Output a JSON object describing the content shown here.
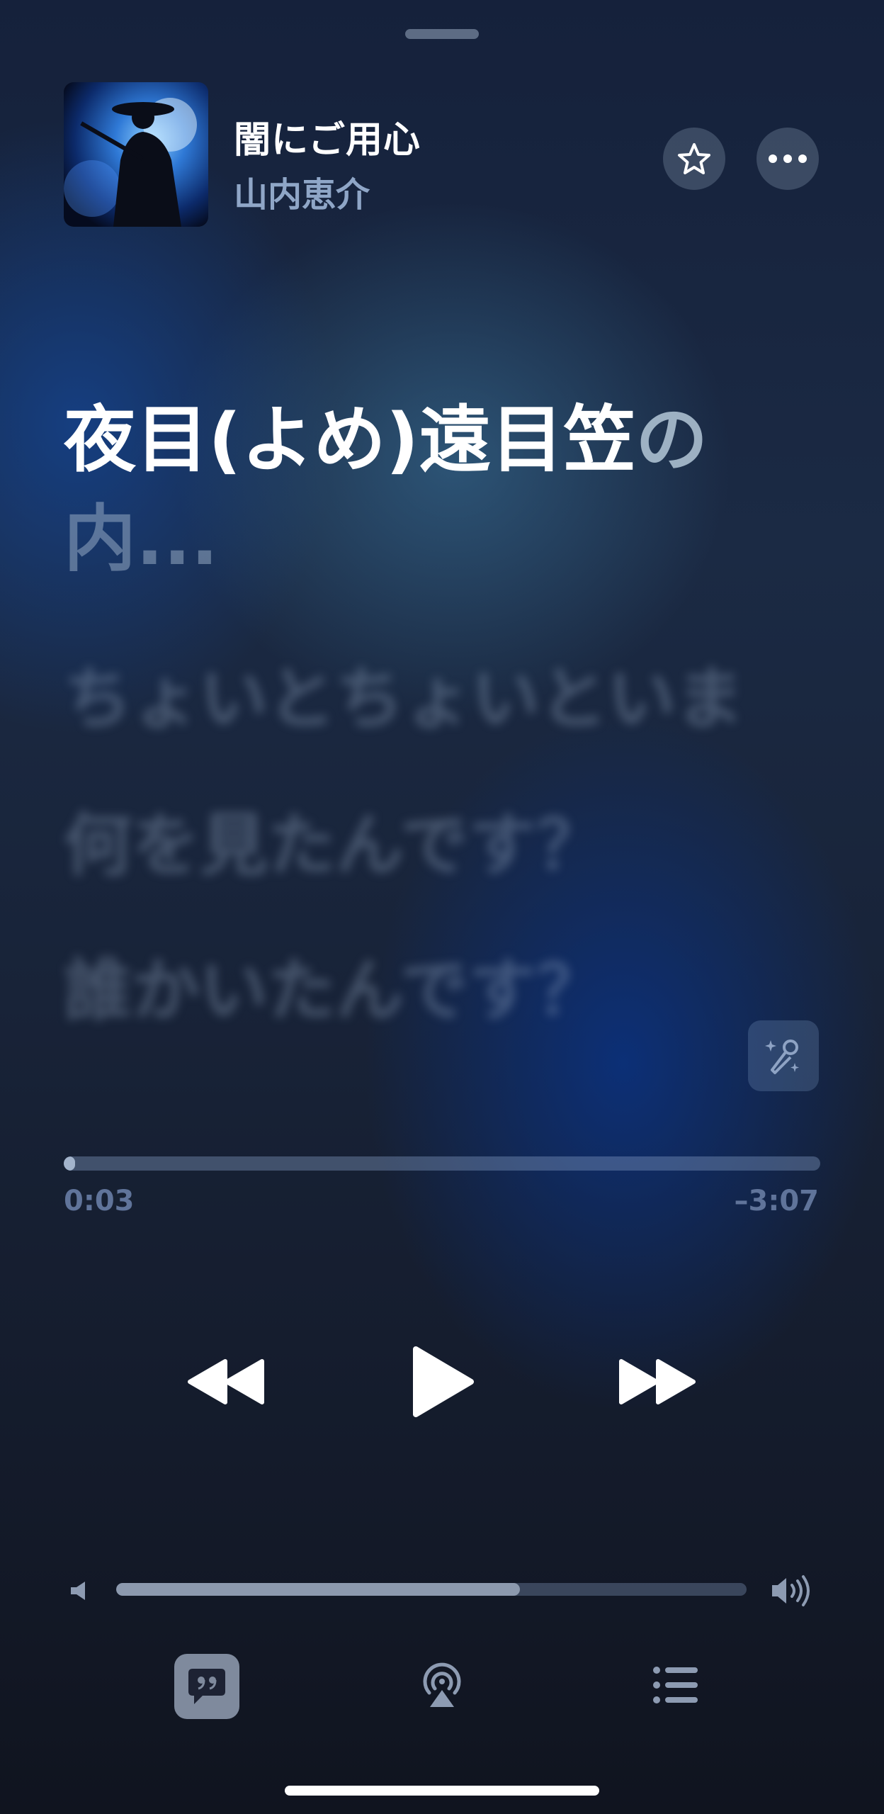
{
  "now_playing": {
    "title": "闇にご用心",
    "artist": "山内恵介"
  },
  "lyrics": {
    "current_main": "夜目(よめ)遠目笠",
    "current_fade1": "の",
    "current_fade2": "内...",
    "next_lines": [
      "ちょいとちょいといま",
      "何を見たんです？",
      "誰かいたんです？"
    ]
  },
  "playback": {
    "elapsed": "0:03",
    "remaining": "–3:07",
    "progress_fraction": 0.015,
    "state": "paused"
  },
  "volume": {
    "level_fraction": 0.64
  },
  "icons": {
    "favorite": "star-icon",
    "more": "ellipsis-icon",
    "sing": "microphone-sparkle-icon",
    "rewind": "backward-icon",
    "play": "play-icon",
    "forward": "forward-icon",
    "lyrics": "quote-bubble-icon",
    "airplay": "airplay-audio-icon",
    "queue": "list-icon"
  },
  "colors": {
    "accent_blue": "#8fa6c7",
    "background": "#15192a"
  }
}
